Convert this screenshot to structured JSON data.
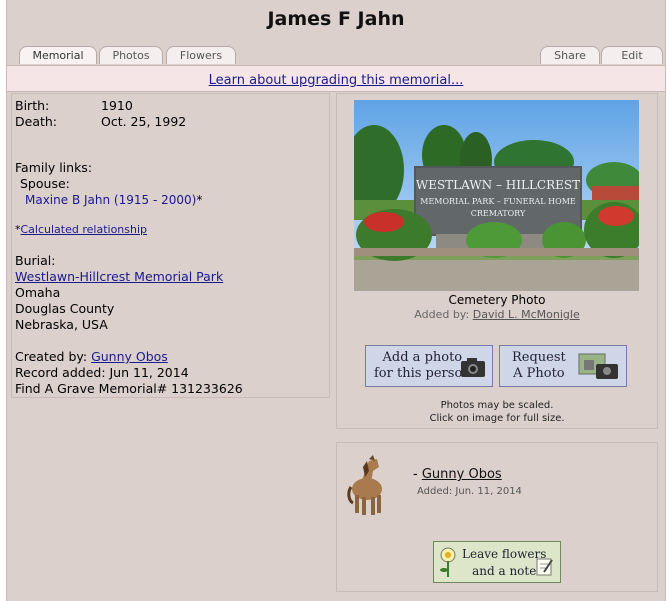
{
  "title": "James F Jahn",
  "tabs": [
    {
      "label": "Memorial"
    },
    {
      "label": "Photos"
    },
    {
      "label": "Flowers"
    },
    {
      "label": "Share"
    },
    {
      "label": "Edit"
    }
  ],
  "upgrade_link": "Learn about upgrading this memorial...",
  "info": {
    "birth_label": "Birth:",
    "birth_value": "1910",
    "death_label": "Death:",
    "death_value": "Oct. 25, 1992",
    "family_links_label": "Family links:",
    "spouse_label": "Spouse:",
    "spouse_value": "Maxine B Jahn (1915 - 2000)",
    "spouse_asterisk": "*",
    "calc_prefix": "*",
    "calc_link": "Calculated relationship",
    "burial_label": "Burial:",
    "cemetery_link": "Westlawn-Hillcrest Memorial Park",
    "city": "Omaha",
    "county": "Douglas County",
    "state_country": "Nebraska, USA",
    "created_by_label": "Created by:",
    "created_by_value": "Gunny Obos",
    "record_added": "Record added: Jun 11, 2014",
    "memorial_id": "Find A Grave Memorial# 131233626"
  },
  "photo": {
    "sign_line1": "WESTLAWN – HILLCREST",
    "sign_line2": "MEMORIAL PARK – FUNERAL HOME",
    "sign_line3": "CREMATORY",
    "caption": "Cemetery Photo",
    "added_by_label": "Added by:",
    "added_by_value": "David L. McMonigle",
    "add_photo_line1": "Add a photo",
    "add_photo_line2": "for this person",
    "request_line1": "Request",
    "request_line2": "A Photo",
    "scaled_note_line1": "Photos may be scaled.",
    "scaled_note_line2": "Click on image for full size."
  },
  "flower": {
    "dash": "-",
    "name": "Gunny Obos",
    "added": "Added: Jun. 11, 2014",
    "button_line1": "Leave flowers",
    "button_line2": "and a note"
  },
  "colors": {
    "background": "#dcd0cd",
    "link": "#1a1a8c",
    "upgrade_bar": "#f5e5e7"
  }
}
